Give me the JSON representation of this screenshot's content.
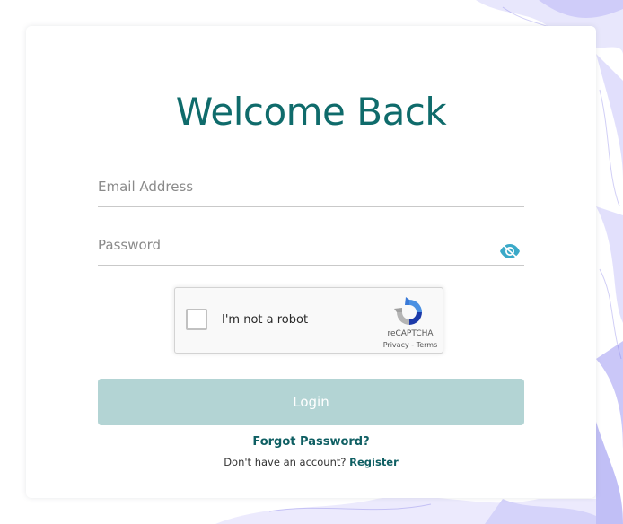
{
  "page": {
    "title": "Welcome Back"
  },
  "form": {
    "email": {
      "value": "",
      "placeholder": "Email Address"
    },
    "password": {
      "value": "",
      "placeholder": "Password"
    },
    "toggle_icon": "eye-icon",
    "login_label": "Login",
    "forgot_label": "Forgot Password?",
    "register_prompt": "Don't have an account?",
    "register_label": "Register"
  },
  "captcha": {
    "checkbox_label": "I'm not a robot",
    "brand": "reCAPTCHA",
    "privacy_label": "Privacy",
    "separator": " - ",
    "terms_label": "Terms",
    "logo_icon": "recaptcha-logo-icon"
  },
  "colors": {
    "brand": "#0f6b6b",
    "login_button": "#b3d4d4",
    "link": "#0f5f63",
    "eye_icon": "#3aa9c8",
    "background_art": "#8f8cf0"
  }
}
